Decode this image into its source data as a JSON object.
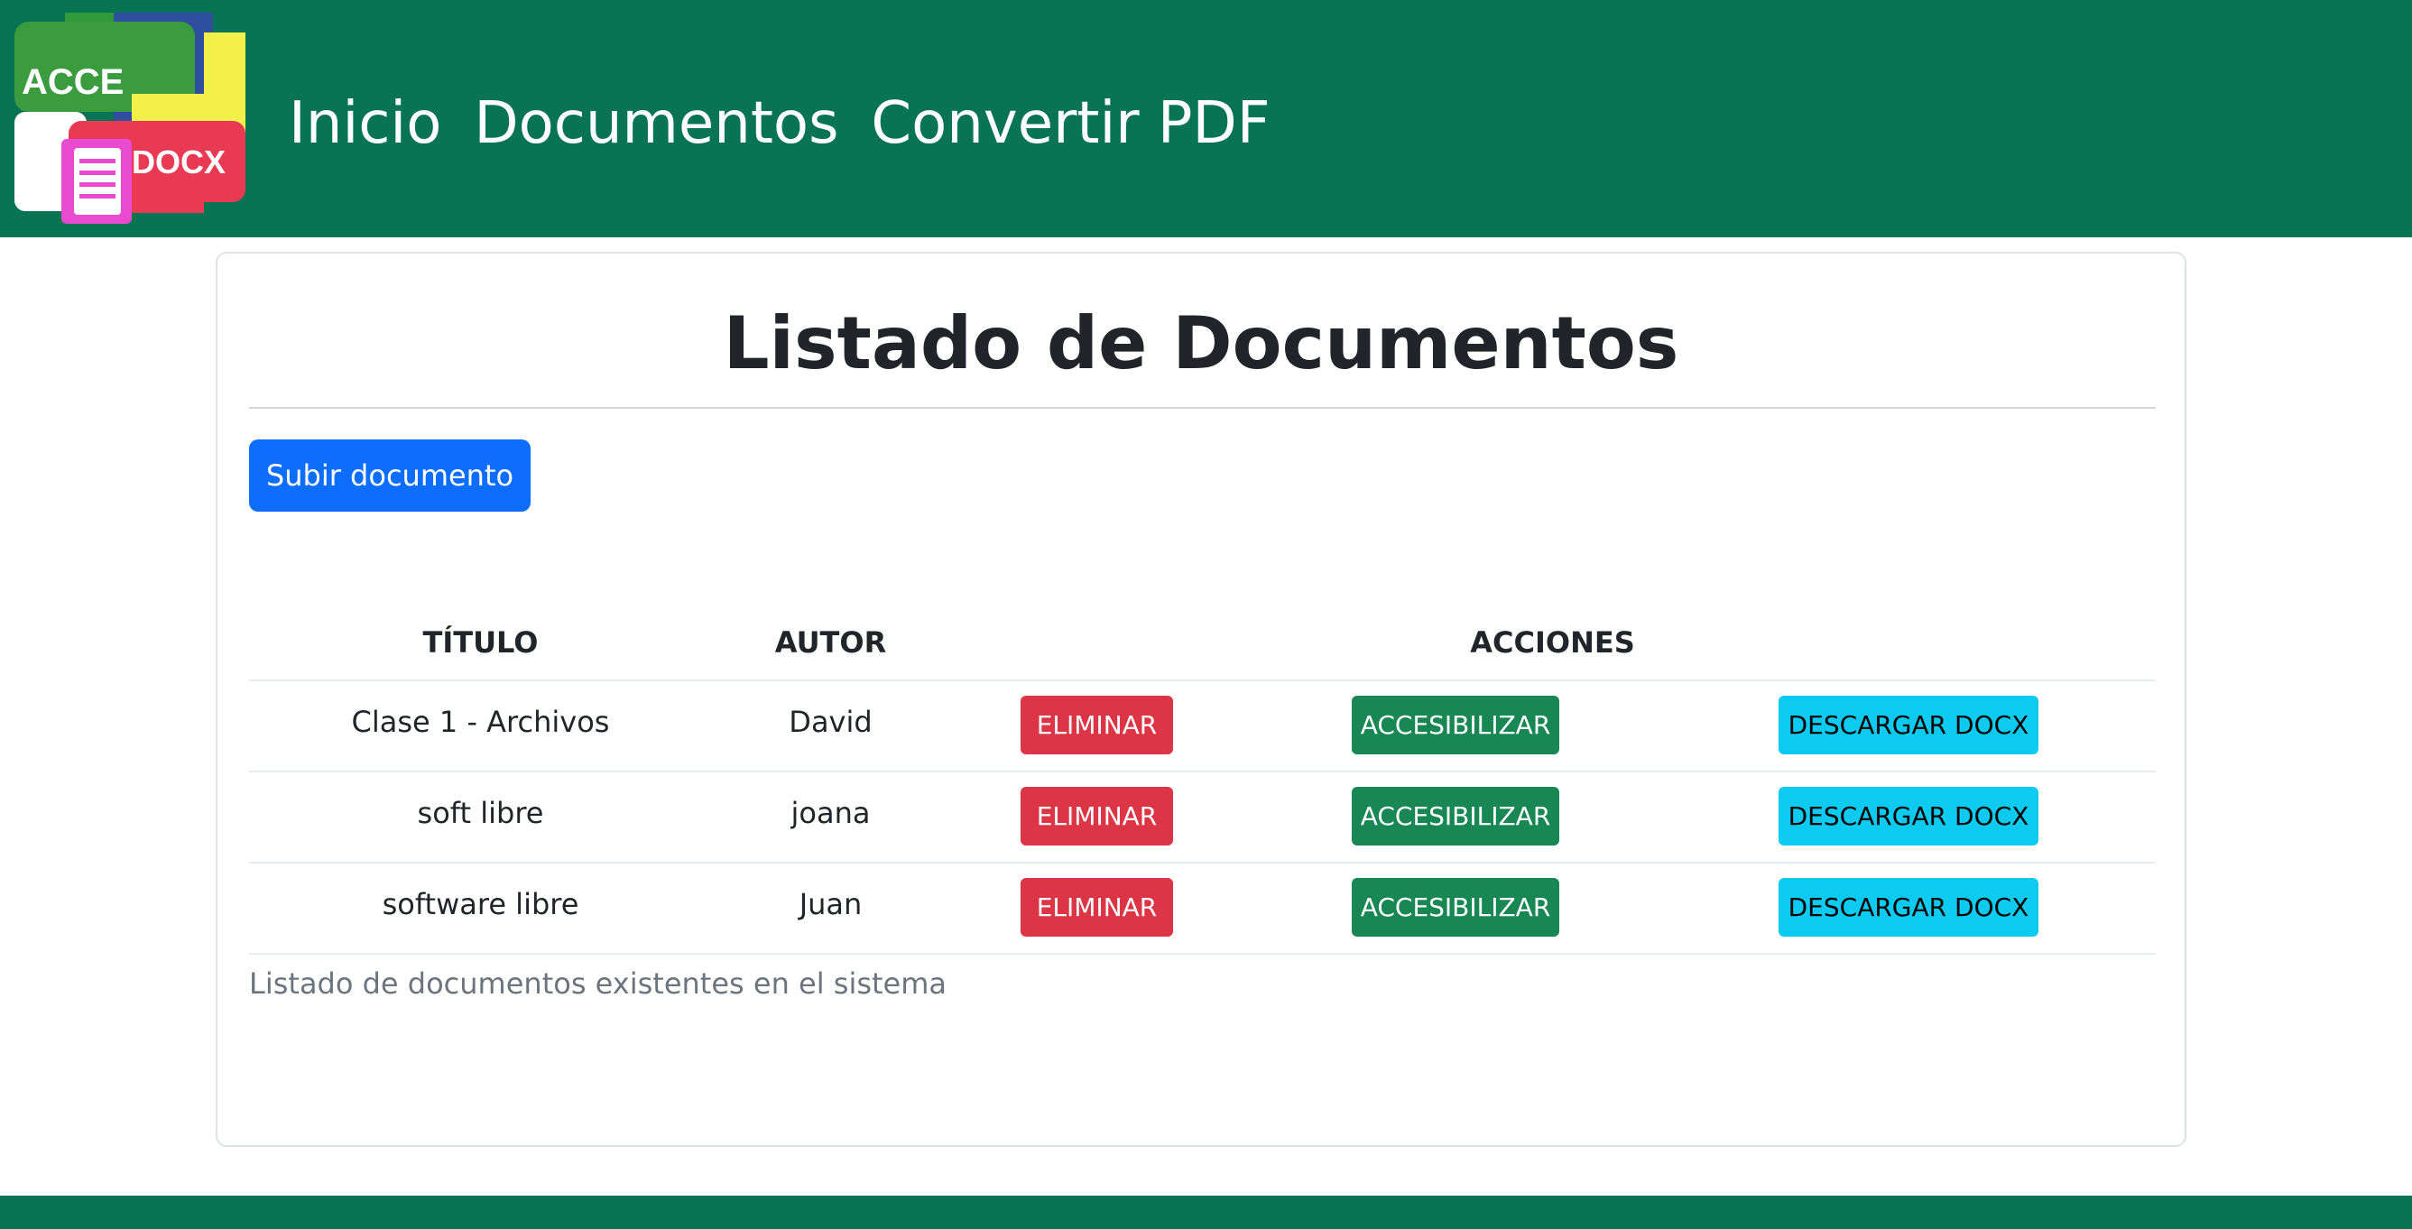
{
  "brand": {
    "logo_text_top": "ACCE",
    "logo_text_bottom": "DOCX",
    "colors": {
      "nav": "#087454",
      "primary": "#0d6efd",
      "danger": "#dc3545",
      "success": "#198754",
      "info": "#0dcaf0"
    }
  },
  "nav": {
    "links": [
      "Inicio",
      "Documentos",
      "Convertir PDF"
    ]
  },
  "main": {
    "title": "Listado de Documentos",
    "upload_label": "Subir documento",
    "table": {
      "headers": {
        "title": "TÍTULO",
        "author": "AUTOR",
        "actions": "ACCIONES"
      },
      "rows": [
        {
          "title": "Clase 1 - Archivos",
          "author": "David",
          "delete": "ELIMINAR",
          "accessibilize": "ACCESIBILIZAR",
          "download": "DESCARGAR DOCX"
        },
        {
          "title": "soft libre",
          "author": "joana",
          "delete": "ELIMINAR",
          "accessibilize": "ACCESIBILIZAR",
          "download": "DESCARGAR DOCX"
        },
        {
          "title": "software libre",
          "author": "Juan",
          "delete": "ELIMINAR",
          "accessibilize": "ACCESIBILIZAR",
          "download": "DESCARGAR DOCX"
        }
      ],
      "caption": "Listado de documentos existentes en el sistema"
    }
  }
}
